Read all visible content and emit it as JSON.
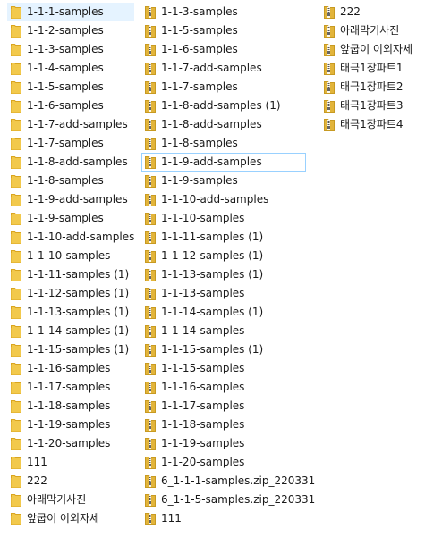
{
  "colors": {
    "folder": "#f2c94c",
    "zip": "#e2b43a",
    "selection": "#e5f3ff"
  },
  "columns": [
    [
      {
        "name": "1-1-1-samples",
        "icon": "folder-icon",
        "selected": true
      },
      {
        "name": "1-1-2-samples",
        "icon": "folder-icon"
      },
      {
        "name": "1-1-3-samples",
        "icon": "folder-icon"
      },
      {
        "name": "1-1-4-samples",
        "icon": "folder-icon"
      },
      {
        "name": "1-1-5-samples",
        "icon": "folder-icon"
      },
      {
        "name": "1-1-6-samples",
        "icon": "folder-icon"
      },
      {
        "name": "1-1-7-add-samples",
        "icon": "folder-icon"
      },
      {
        "name": "1-1-7-samples",
        "icon": "folder-icon"
      },
      {
        "name": "1-1-8-add-samples",
        "icon": "folder-icon"
      },
      {
        "name": "1-1-8-samples",
        "icon": "folder-icon"
      },
      {
        "name": "1-1-9-add-samples",
        "icon": "folder-icon"
      },
      {
        "name": "1-1-9-samples",
        "icon": "folder-icon"
      },
      {
        "name": "1-1-10-add-samples",
        "icon": "folder-icon"
      },
      {
        "name": "1-1-10-samples",
        "icon": "folder-icon"
      },
      {
        "name": "1-1-11-samples (1)",
        "icon": "folder-icon"
      },
      {
        "name": "1-1-12-samples (1)",
        "icon": "folder-icon"
      },
      {
        "name": "1-1-13-samples (1)",
        "icon": "folder-icon"
      },
      {
        "name": "1-1-14-samples (1)",
        "icon": "folder-icon"
      },
      {
        "name": "1-1-15-samples (1)",
        "icon": "folder-icon"
      },
      {
        "name": "1-1-16-samples",
        "icon": "folder-icon"
      },
      {
        "name": "1-1-17-samples",
        "icon": "folder-icon"
      },
      {
        "name": "1-1-18-samples",
        "icon": "folder-icon"
      },
      {
        "name": "1-1-19-samples",
        "icon": "folder-icon"
      },
      {
        "name": "1-1-20-samples",
        "icon": "folder-icon"
      },
      {
        "name": "111",
        "icon": "folder-icon"
      },
      {
        "name": "222",
        "icon": "folder-icon"
      },
      {
        "name": "아래막기사진",
        "icon": "folder-icon"
      },
      {
        "name": "앞굽이 이외자세",
        "icon": "folder-icon"
      }
    ],
    [
      {
        "name": "1-1-3-samples",
        "icon": "zip-icon"
      },
      {
        "name": "1-1-5-samples",
        "icon": "zip-icon"
      },
      {
        "name": "1-1-6-samples",
        "icon": "zip-icon"
      },
      {
        "name": "1-1-7-add-samples",
        "icon": "zip-icon"
      },
      {
        "name": "1-1-7-samples",
        "icon": "zip-icon"
      },
      {
        "name": "1-1-8-add-samples (1)",
        "icon": "zip-icon"
      },
      {
        "name": "1-1-8-add-samples",
        "icon": "zip-icon"
      },
      {
        "name": "1-1-8-samples",
        "icon": "zip-icon"
      },
      {
        "name": "1-1-9-add-samples",
        "icon": "zip-icon",
        "focused": true
      },
      {
        "name": "1-1-9-samples",
        "icon": "zip-icon"
      },
      {
        "name": "1-1-10-add-samples",
        "icon": "zip-icon"
      },
      {
        "name": "1-1-10-samples",
        "icon": "zip-icon"
      },
      {
        "name": "1-1-11-samples (1)",
        "icon": "zip-icon"
      },
      {
        "name": "1-1-12-samples (1)",
        "icon": "zip-icon"
      },
      {
        "name": "1-1-13-samples (1)",
        "icon": "zip-icon"
      },
      {
        "name": "1-1-13-samples",
        "icon": "zip-icon"
      },
      {
        "name": "1-1-14-samples (1)",
        "icon": "zip-icon"
      },
      {
        "name": "1-1-14-samples",
        "icon": "zip-icon"
      },
      {
        "name": "1-1-15-samples (1)",
        "icon": "zip-icon"
      },
      {
        "name": "1-1-15-samples",
        "icon": "zip-icon"
      },
      {
        "name": "1-1-16-samples",
        "icon": "zip-icon"
      },
      {
        "name": "1-1-17-samples",
        "icon": "zip-icon"
      },
      {
        "name": "1-1-18-samples",
        "icon": "zip-icon"
      },
      {
        "name": "1-1-19-samples",
        "icon": "zip-icon"
      },
      {
        "name": "1-1-20-samples",
        "icon": "zip-icon"
      },
      {
        "name": "6_1-1-1-samples.zip_220331",
        "icon": "zip-icon"
      },
      {
        "name": "6_1-1-5-samples.zip_220331",
        "icon": "zip-icon"
      },
      {
        "name": "111",
        "icon": "zip-icon"
      }
    ],
    [
      {
        "name": "222",
        "icon": "zip-icon"
      },
      {
        "name": "아래막기사진",
        "icon": "zip-icon"
      },
      {
        "name": "앞굽이 이외자세",
        "icon": "zip-icon"
      },
      {
        "name": "태극1장파트1",
        "icon": "zip-icon"
      },
      {
        "name": "태극1장파트2",
        "icon": "zip-icon"
      },
      {
        "name": "태극1장파트3",
        "icon": "zip-icon"
      },
      {
        "name": "태극1장파트4",
        "icon": "zip-icon"
      }
    ]
  ]
}
